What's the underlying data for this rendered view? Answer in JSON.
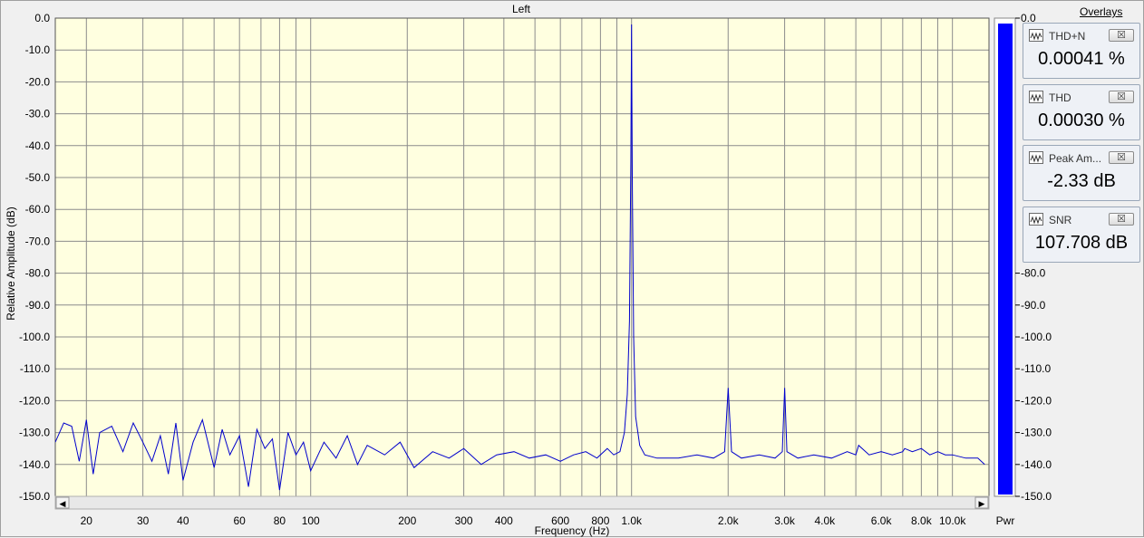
{
  "window": {
    "title": "Left",
    "overlays_label": "Overlays",
    "meter_label": "Pwr"
  },
  "chart_data": {
    "type": "line",
    "title": "Left",
    "xlabel": "Frequency (Hz)",
    "ylabel": "Relative Amplitude (dB)",
    "x_scale": "log",
    "xlim": [
      16,
      13000
    ],
    "ylim": [
      -150,
      0
    ],
    "x_ticks": [
      {
        "v": 20,
        "label": "20"
      },
      {
        "v": 30,
        "label": "30"
      },
      {
        "v": 40,
        "label": "40"
      },
      {
        "v": 60,
        "label": "60"
      },
      {
        "v": 80,
        "label": "80"
      },
      {
        "v": 100,
        "label": "100"
      },
      {
        "v": 200,
        "label": "200"
      },
      {
        "v": 300,
        "label": "300"
      },
      {
        "v": 400,
        "label": "400"
      },
      {
        "v": 600,
        "label": "600"
      },
      {
        "v": 800,
        "label": "800"
      },
      {
        "v": 1000,
        "label": "1.0k"
      },
      {
        "v": 2000,
        "label": "2.0k"
      },
      {
        "v": 3000,
        "label": "3.0k"
      },
      {
        "v": 4000,
        "label": "4.0k"
      },
      {
        "v": 6000,
        "label": "6.0k"
      },
      {
        "v": 8000,
        "label": "8.0k"
      },
      {
        "v": 10000,
        "label": "10.0k"
      }
    ],
    "y_ticks": [
      "0.0",
      "-10.0",
      "-20.0",
      "-30.0",
      "-40.0",
      "-50.0",
      "-60.0",
      "-70.0",
      "-80.0",
      "-90.0",
      "-100.0",
      "-110.0",
      "-120.0",
      "-130.0",
      "-140.0",
      "-150.0"
    ],
    "grid": true,
    "background": "#ffffe0",
    "series": [
      {
        "color": "#0000cc",
        "x": [
          16,
          17,
          18,
          19,
          20,
          21,
          22,
          24,
          26,
          28,
          30,
          32,
          34,
          36,
          38,
          40,
          43,
          46,
          50,
          53,
          56,
          60,
          64,
          68,
          72,
          76,
          80,
          85,
          90,
          95,
          100,
          110,
          120,
          130,
          140,
          150,
          170,
          190,
          210,
          240,
          270,
          300,
          340,
          380,
          430,
          480,
          540,
          600,
          660,
          720,
          780,
          840,
          880,
          920,
          950,
          970,
          985,
          995,
          1000,
          1005,
          1015,
          1030,
          1060,
          1100,
          1200,
          1400,
          1600,
          1800,
          1950,
          2000,
          2050,
          2200,
          2500,
          2800,
          2950,
          3000,
          3050,
          3300,
          3700,
          4200,
          4700,
          5000,
          5100,
          5500,
          6000,
          6500,
          7000,
          7100,
          7500,
          8000,
          8500,
          9000,
          9500,
          10000,
          11000,
          12000,
          12600
        ],
        "y": [
          -133,
          -127,
          -128,
          -139,
          -126,
          -143,
          -130,
          -128,
          -136,
          -127,
          -133,
          -139,
          -131,
          -143,
          -127,
          -145,
          -133,
          -126,
          -141,
          -129,
          -137,
          -131,
          -147,
          -129,
          -135,
          -132,
          -148,
          -130,
          -137,
          -133,
          -142,
          -133,
          -138,
          -131,
          -140,
          -134,
          -137,
          -133,
          -141,
          -136,
          -138,
          -135,
          -140,
          -137,
          -136,
          -138,
          -137,
          -139,
          -137,
          -136,
          -138,
          -135,
          -137,
          -136,
          -130,
          -118,
          -95,
          -45,
          -2,
          -50,
          -100,
          -125,
          -134,
          -137,
          -138,
          -138,
          -137,
          -138,
          -136,
          -116,
          -136,
          -138,
          -137,
          -138,
          -136,
          -116,
          -136,
          -138,
          -137,
          -138,
          -136,
          -137,
          -134,
          -137,
          -136,
          -137,
          -136,
          -135,
          -136,
          -135,
          -137,
          -136,
          -137,
          -137,
          -138,
          -138,
          -140
        ]
      }
    ],
    "meter": {
      "type": "bar",
      "ylim": [
        -150,
        0
      ],
      "values": [
        0
      ],
      "color": "#0000ff",
      "y_ticks": [
        "0.0",
        "-80.0",
        "-90.0",
        "-100.0",
        "-110.0",
        "-120.0",
        "-130.0",
        "-140.0",
        "-150.0"
      ]
    }
  },
  "overlays": [
    {
      "name": "THD+N",
      "value": "0.00041 %",
      "close": "☒"
    },
    {
      "name": "THD",
      "value": "0.00030 %",
      "close": "☒"
    },
    {
      "name": "Peak Am...",
      "value": "-2.33 dB",
      "close": "☒"
    },
    {
      "name": "SNR",
      "value": "107.708 dB",
      "close": "☒"
    }
  ],
  "scrollbar": {
    "left_arrow": "◀",
    "right_arrow": "▶"
  }
}
